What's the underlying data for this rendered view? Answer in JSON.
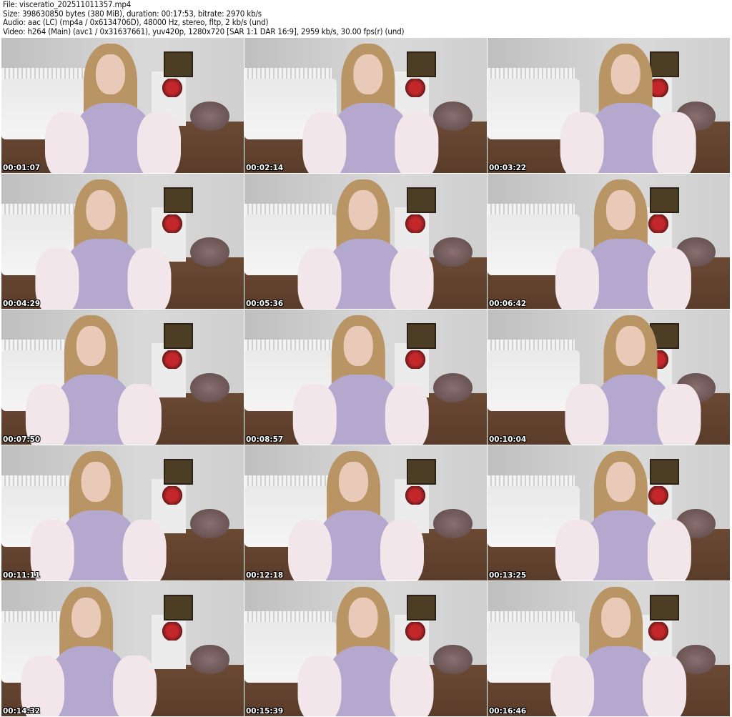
{
  "header": {
    "file": "File: visceratio_202511011357.mp4",
    "size": "Size: 398630850 bytes (380 MiB), duration: 00:17:53, bitrate: 2970 kb/s",
    "audio": "Audio: aac (LC) (mp4a / 0x6134706D), 48000 Hz, stereo, fltp, 2 kb/s (und)",
    "video": "Video: h264 (Main) (avc1 / 0x31637661), yuv420p, 1280x720 [SAR 1:1 DAR 16:9], 2959 kb/s, 30.00 fps(r) (und)"
  },
  "thumbnails": [
    {
      "timestamp": "00:01:07"
    },
    {
      "timestamp": "00:02:14"
    },
    {
      "timestamp": "00:03:22"
    },
    {
      "timestamp": "00:04:29"
    },
    {
      "timestamp": "00:05:36"
    },
    {
      "timestamp": "00:06:42"
    },
    {
      "timestamp": "00:07:50"
    },
    {
      "timestamp": "00:08:57"
    },
    {
      "timestamp": "00:10:04"
    },
    {
      "timestamp": "00:11:11"
    },
    {
      "timestamp": "00:12:18"
    },
    {
      "timestamp": "00:13:25"
    },
    {
      "timestamp": "00:14:32"
    },
    {
      "timestamp": "00:15:39"
    },
    {
      "timestamp": "00:16:46"
    }
  ]
}
